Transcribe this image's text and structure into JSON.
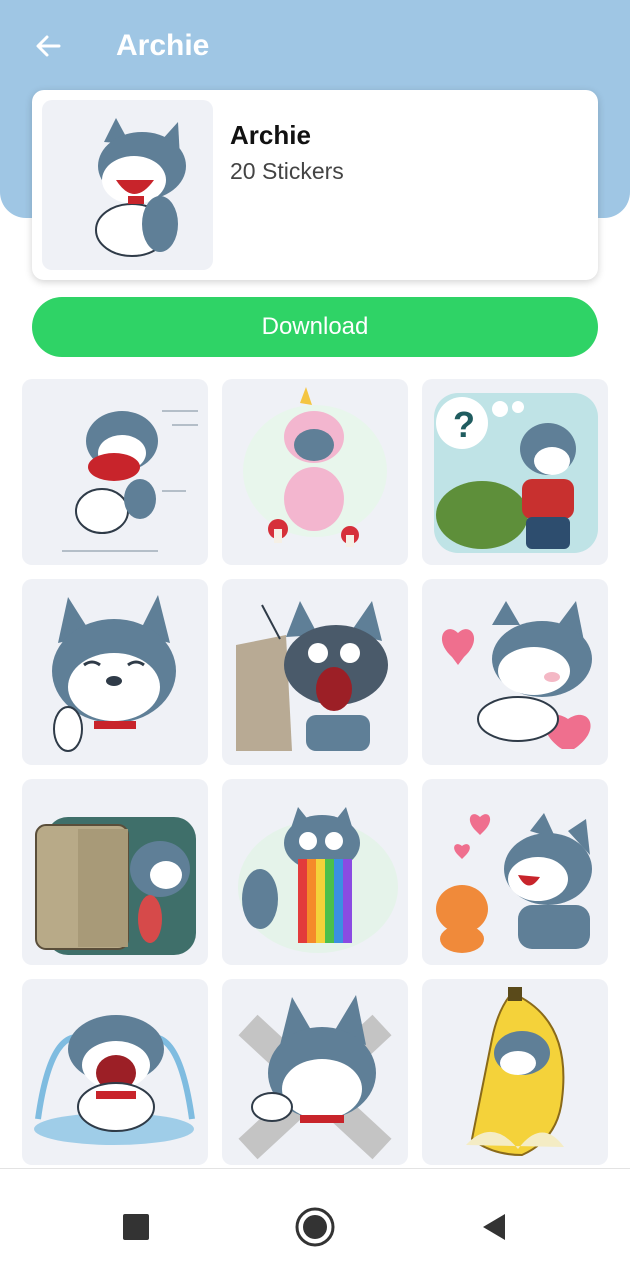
{
  "header": {
    "title": "Archie",
    "back_icon": "arrow-left-icon",
    "background_color": "#9fc6e4"
  },
  "pack": {
    "name": "Archie",
    "count_label": "20 Stickers"
  },
  "download": {
    "label": "Download",
    "color": "#2fd366"
  },
  "stickers": [
    {
      "name": "sticker-running-meat"
    },
    {
      "name": "sticker-unicorn-costume"
    },
    {
      "name": "sticker-thinking-question"
    },
    {
      "name": "sticker-peace-smile"
    },
    {
      "name": "sticker-shocked-wall"
    },
    {
      "name": "sticker-blowing-kiss"
    },
    {
      "name": "sticker-fridge-peek"
    },
    {
      "name": "sticker-rainbow-vomit"
    },
    {
      "name": "sticker-hug-cat"
    },
    {
      "name": "sticker-crying"
    },
    {
      "name": "sticker-thumbs-down"
    },
    {
      "name": "sticker-banana"
    }
  ],
  "navbar": {
    "icons": [
      "square-stop-icon",
      "circle-home-icon",
      "triangle-back-icon"
    ]
  }
}
